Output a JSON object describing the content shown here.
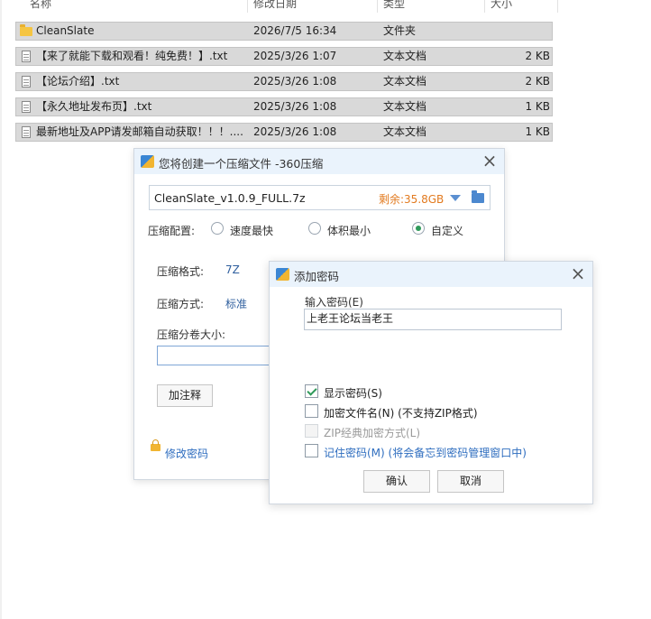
{
  "explorer": {
    "columns": {
      "name": "名称",
      "date": "修改日期",
      "type": "类型",
      "size": "大小"
    },
    "rows": [
      {
        "name": "CleanSlate",
        "date": "2026/7/5 16:34",
        "type": "文件夹",
        "size": "",
        "icon": "folder-icon"
      },
      {
        "name": "【来了就能下载和观看！纯免费！】.txt",
        "date": "2025/3/26 1:07",
        "type": "文本文档",
        "size": "2 KB",
        "icon": "text-file-icon"
      },
      {
        "name": "【论坛介绍】.txt",
        "date": "2025/3/26 1:08",
        "type": "文本文档",
        "size": "2 KB",
        "icon": "text-file-icon"
      },
      {
        "name": "【永久地址发布页】.txt",
        "date": "2025/3/26 1:08",
        "type": "文本文档",
        "size": "1 KB",
        "icon": "text-file-icon"
      },
      {
        "name": "最新地址及APP请发邮箱自动获取！！！....",
        "date": "2025/3/26 1:08",
        "type": "文本文档",
        "size": "1 KB",
        "icon": "text-file-icon"
      }
    ]
  },
  "compress_dialog": {
    "title": "您将创建一个压缩文件 -360压缩",
    "close": "×",
    "filename": "CleanSlate_v1.0.9_FULL.7z",
    "free_space": "剩余:35.8GB",
    "config_label": "压缩配置:",
    "options": [
      {
        "label": "速度最快",
        "selected": false
      },
      {
        "label": "体积最小",
        "selected": false
      },
      {
        "label": "自定义",
        "selected": true
      }
    ],
    "format_label": "压缩格式:",
    "format_value": "7Z",
    "method_label": "压缩方式:",
    "method_value": "标准",
    "split_label": "压缩分卷大小:",
    "comment_button": "加注释",
    "change_password": "修改密码"
  },
  "password_dialog": {
    "title": "添加密码",
    "close": "×",
    "input_label": "输入密码(E)",
    "password_value": "上老王论坛当老王",
    "checkboxes": [
      {
        "label": "显示密码(S)",
        "checked": true,
        "disabled": false,
        "style": "normal"
      },
      {
        "label": "加密文件名(N) (不支持ZIP格式)",
        "checked": false,
        "disabled": false,
        "style": "normal"
      },
      {
        "label": "ZIP经典加密方式(L)",
        "checked": false,
        "disabled": true,
        "style": "disabled"
      },
      {
        "label": "记住密码(M) (将会备忘到密码管理窗口中)",
        "checked": false,
        "disabled": false,
        "style": "blue"
      }
    ],
    "ok_button": "确认",
    "cancel_button": "取消"
  },
  "colors": {
    "accent_green": "#2f9a5a",
    "free_space_orange": "#e27a1f",
    "link_blue": "#2e6dbf",
    "row_selected_bg": "#d9d9d9"
  }
}
